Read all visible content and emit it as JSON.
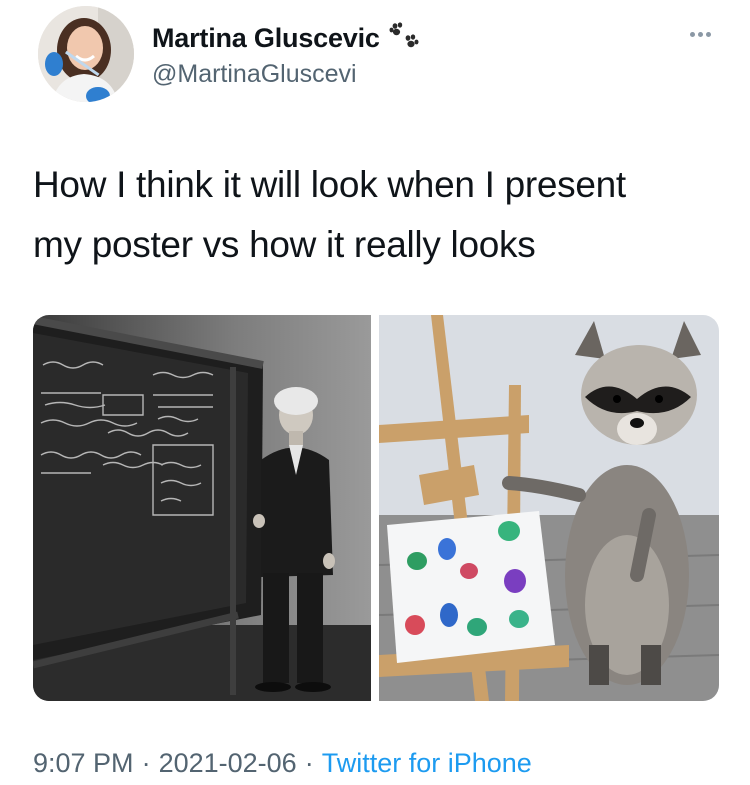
{
  "tweet": {
    "author": {
      "display_name": "Martina Gluscevic",
      "handle": "@MartinaGluscevi",
      "name_emoji": "paw-prints-icon"
    },
    "text_line1": "How I think it will look when I present",
    "text_line2": "my poster vs how it really looks",
    "media": {
      "left_image": "black-and-white photo of a man in a suit standing beside a chalkboard covered in equations",
      "right_image": "raccoon standing on hind legs beside an easel holding paper with colorful paint handprints"
    },
    "time": "9:07 PM",
    "date": "2021-02-06",
    "separator": "·",
    "source": "Twitter for iPhone"
  },
  "colors": {
    "text_primary": "#0f1419",
    "text_secondary": "#536471",
    "link": "#1d9bf0"
  }
}
